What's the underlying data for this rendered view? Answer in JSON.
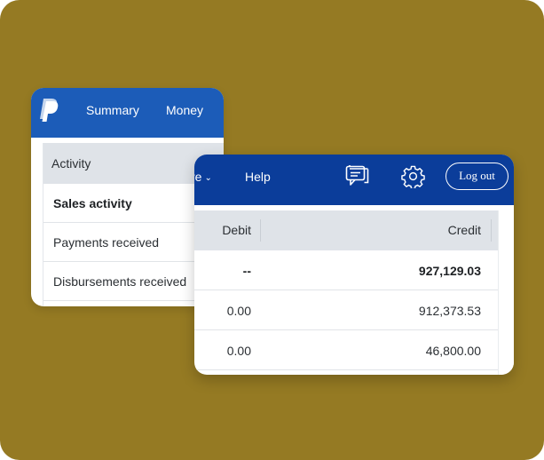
{
  "colors": {
    "background": "#957a23",
    "back_header": "#1c5cb8",
    "front_header": "#0b3d9a",
    "table_header": "#dfe3e8"
  },
  "back_card": {
    "logo_icon": "paypal-logo-icon",
    "nav": {
      "summary": "Summary",
      "money": "Money"
    },
    "menu": {
      "header": "Activity",
      "items": [
        {
          "label": "Sales activity",
          "bold": true
        },
        {
          "label": "Payments received",
          "bold": false
        },
        {
          "label": "Disbursements received",
          "bold": false
        }
      ]
    }
  },
  "front_card": {
    "nav": {
      "more_partial": "re",
      "help": "Help"
    },
    "icons": {
      "messages": "message-center-icon",
      "settings": "gear-icon"
    },
    "logout_label": "Log out",
    "table": {
      "headers": {
        "debit": "Debit",
        "credit": "Credit"
      },
      "rows": [
        {
          "debit": "--",
          "credit": "927,129.03",
          "bold": true
        },
        {
          "debit": "0.00",
          "credit": "912,373.53",
          "bold": false
        },
        {
          "debit": "0.00",
          "credit": "46,800.00",
          "bold": false
        }
      ]
    }
  }
}
